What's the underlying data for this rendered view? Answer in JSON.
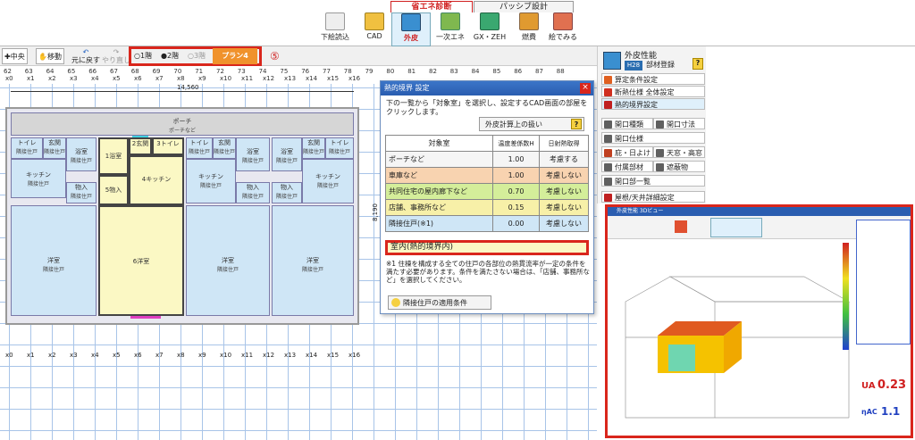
{
  "top_toolbar": {
    "tabs": {
      "active": "省エネ診断",
      "passive": "パッシブ設計"
    },
    "buttons": [
      {
        "label": "下絵読込",
        "icon": "underlay-icon"
      },
      {
        "label": "CAD",
        "icon": "cad-icon"
      },
      {
        "label": "外皮",
        "icon": "envelope-ua-icon"
      },
      {
        "label": "一次エネ",
        "icon": "primary-energy-icon"
      },
      {
        "label": "GX・ZEH",
        "icon": "gx-zeh-icon"
      },
      {
        "label": "燃費",
        "icon": "fuel-cost-icon"
      },
      {
        "label": "絵でみる",
        "icon": "picture-view-icon"
      }
    ]
  },
  "second_toolbar": {
    "center_label": "中央",
    "move_label": "移動",
    "undo_label": "元に戻す",
    "redo_label": "やり直し",
    "floors": [
      "1階",
      "2階",
      "3階"
    ],
    "selected_floor": "2階",
    "plan_label": "プラン4",
    "callout": "⑤"
  },
  "ruler": {
    "top_numbers": [
      "62",
      "63",
      "64",
      "65",
      "66",
      "67",
      "68",
      "69",
      "70",
      "71",
      "72",
      "73",
      "74",
      "75",
      "76",
      "77",
      "78",
      "79",
      "80",
      "81",
      "82",
      "83",
      "84",
      "85",
      "86",
      "87",
      "88"
    ],
    "x_labels": [
      "x0",
      "x1",
      "x2",
      "x3",
      "x4",
      "x5",
      "x6",
      "x7",
      "x8",
      "x9",
      "x10",
      "x11",
      "x12",
      "x13",
      "x14",
      "x15",
      "x16"
    ],
    "width_dim": "14,560",
    "height_dim": "8,190"
  },
  "floor_plan": {
    "rooms": [
      {
        "name": "ポーチ",
        "sub": "ポーチなど"
      },
      {
        "name": "トイレ",
        "sub": "隣接住戸"
      },
      {
        "name": "玄関",
        "sub": "隣接住戸"
      },
      {
        "name": "浴室",
        "sub": "隣接住戸"
      },
      {
        "name": "1浴室",
        "sub": ""
      },
      {
        "name": "2玄関",
        "sub": ""
      },
      {
        "name": "3トイレ",
        "sub": ""
      },
      {
        "name": "4キッチン",
        "sub": ""
      },
      {
        "name": "5物入",
        "sub": ""
      },
      {
        "name": "6洋室",
        "sub": ""
      },
      {
        "name": "キッチン",
        "sub": "隣接住戸"
      },
      {
        "name": "物入",
        "sub": "隣接住戸"
      },
      {
        "name": "洋室",
        "sub": "隣接住戸"
      }
    ]
  },
  "dialog": {
    "title": "熱的境界 設定",
    "instructions": "下の一覧から「対象室」を選択し、設定するCAD画面の部屋をクリックします。",
    "calc_button": "外皮計算上の扱い",
    "headers": {
      "room": "対象室",
      "coef": "温度差係数H",
      "solar": "日射熱取得"
    },
    "rows": [
      {
        "room": "ポーチなど",
        "coef": "1.00",
        "solar": "考慮する",
        "color": "#f5f5f5"
      },
      {
        "room": "車庫など",
        "coef": "1.00",
        "solar": "考慮しない",
        "color": "#f8d3b0"
      },
      {
        "room": "共同住宅の屋内廊下など",
        "coef": "0.70",
        "solar": "考慮しない",
        "color": "#d4ee9a"
      },
      {
        "room": "店舗、事務所など",
        "coef": "0.15",
        "solar": "考慮しない",
        "color": "#f7f0a8"
      },
      {
        "room": "隣接住戸(※1)",
        "coef": "0.00",
        "solar": "考慮しない",
        "color": "#cfe6f6"
      }
    ],
    "interior_row": "室内(熱的境界内)",
    "note": "※1 住棟を構成する全ての住戸の各部位の熱貫流率が一定の条件を満たす必要があります。条件を満たさない場合は、「店舗、事務所など」を選択してください。",
    "apply_button": "隣接住戸の適用条件"
  },
  "right_panel": {
    "header": "外皮性能",
    "h28": "H28",
    "register": "部材登録",
    "items": [
      {
        "label": "算定条件設定",
        "color": "#e06020"
      },
      {
        "label": "断熱仕様 全体設定",
        "color": "#d03020"
      },
      {
        "label": "熱的境界設定",
        "color": "#c02020"
      },
      {
        "label": "開口種類",
        "color": "#606060"
      },
      {
        "label": "開口寸法",
        "color": "#606060"
      },
      {
        "label": "開口仕様",
        "color": "#606060"
      },
      {
        "label": "庇・日よけ",
        "color": "#c04020"
      },
      {
        "label": "天窓・高窓",
        "color": "#606060"
      },
      {
        "label": "付属部材",
        "color": "#606060"
      },
      {
        "label": "遮蔽物",
        "color": "#606060"
      },
      {
        "label": "開口部一覧",
        "color": "#606060"
      },
      {
        "label": "屋根/天井詳細設定",
        "color": "#c02020"
      }
    ]
  },
  "view3d": {
    "title": "外皮性能 3Dビュー",
    "ua_label": "UA",
    "ua_value": "0.23",
    "eta_label": "ηAC",
    "eta_value": "1.1"
  }
}
